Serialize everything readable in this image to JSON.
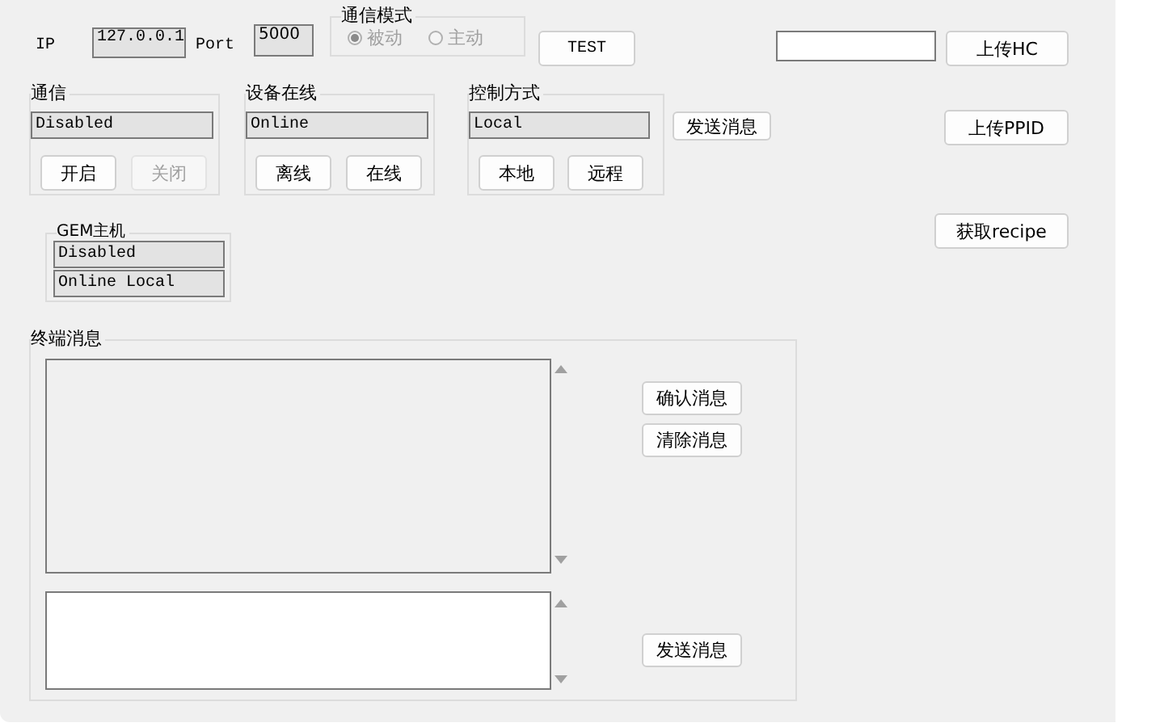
{
  "connection": {
    "ip_label": "IP",
    "ip": "127.0.0.1",
    "port_label": "Port",
    "port": "5000"
  },
  "mode_group": {
    "title": "通信模式",
    "disabled": true,
    "options": [
      {
        "label": "被动",
        "selected": true
      },
      {
        "label": "主动",
        "selected": false
      }
    ]
  },
  "test_button": "TEST",
  "right_buttons": [
    "上传HC",
    "上传PPID",
    "获取recipe"
  ],
  "groups": [
    {
      "title": "通信",
      "status": "Disabled",
      "buttons": [
        {
          "label": "开启",
          "disabled": false
        },
        {
          "label": "关闭",
          "disabled": true
        }
      ]
    },
    {
      "title": "设备在线",
      "status": "Online",
      "buttons": [
        {
          "label": "离线",
          "disabled": false
        },
        {
          "label": "在线",
          "disabled": false
        }
      ]
    },
    {
      "title": "控制方式",
      "status": "Local",
      "buttons": [
        {
          "label": "本地",
          "disabled": false
        },
        {
          "label": "远程",
          "disabled": false
        }
      ]
    }
  ],
  "send_button": "发送消息",
  "gem_host": {
    "title": "GEM主机",
    "lines": [
      "Disabled",
      "Online Local"
    ]
  },
  "terminal": {
    "title": "终端消息",
    "buttons": [
      "确认消息",
      "清除消息"
    ],
    "send_button": "发送消息"
  }
}
